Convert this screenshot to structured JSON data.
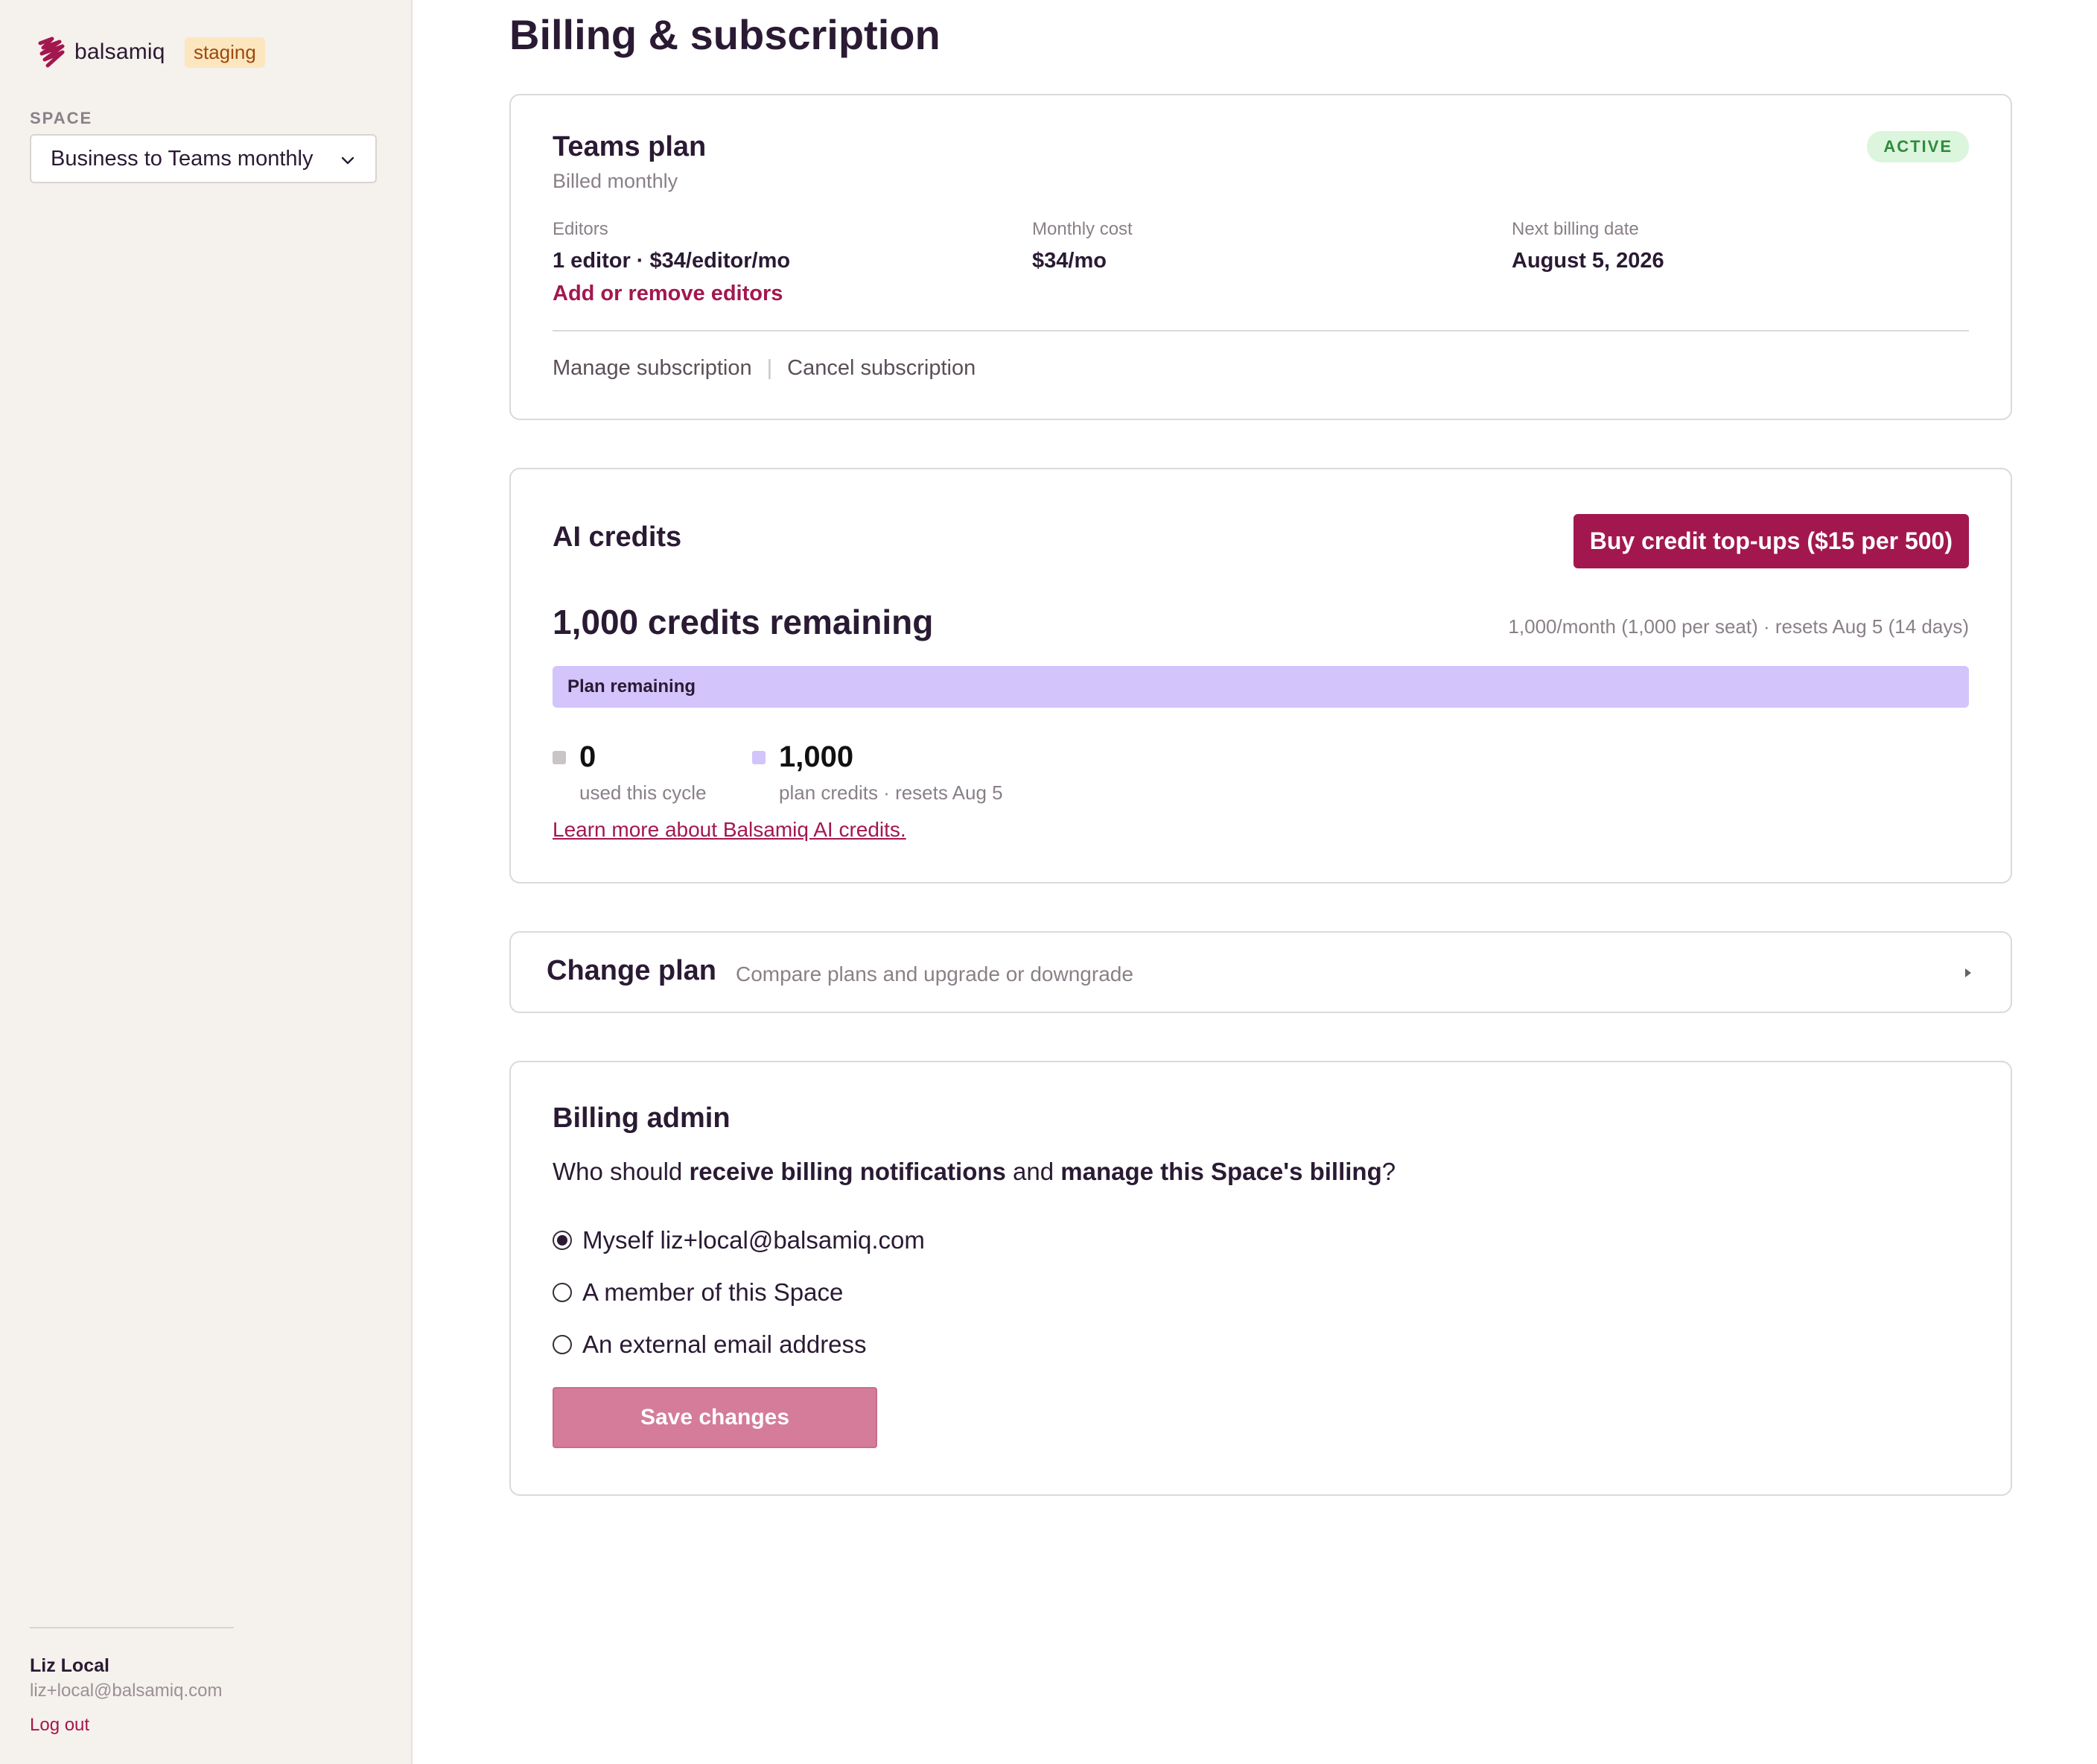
{
  "sidebar": {
    "brand": "balsamiq",
    "env_badge": "staging",
    "space_label": "SPACE",
    "space_value": "Business to Teams monthly",
    "user": {
      "name": "Liz Local",
      "email": "liz+local@balsamiq.com",
      "logout": "Log out"
    }
  },
  "page": {
    "title": "Billing & subscription"
  },
  "plan": {
    "title": "Teams plan",
    "subtitle": "Billed monthly",
    "status": "ACTIVE",
    "editors_label": "Editors",
    "editors_value": "1 editor · $34/editor/mo",
    "cost_label": "Monthly cost",
    "cost_value": "$34/mo",
    "next_label": "Next billing date",
    "next_value": "August 5, 2026",
    "add_editors": "Add or remove editors",
    "manage": "Manage subscription",
    "separator": "|",
    "cancel": "Cancel subscription"
  },
  "credits": {
    "title": "AI credits",
    "buy_button": "Buy credit top-ups ($15 per 500)",
    "remaining": "1,000 credits remaining",
    "cycle_info": "1,000/month (1,000 per seat) · resets Aug 5 (14 days)",
    "bar_label": "Plan remaining",
    "bar_fraction": 1.0,
    "used_value": "0",
    "used_desc": "used this cycle",
    "plan_value": "1,000",
    "plan_desc": "plan credits · resets Aug 5",
    "learn_link": "Learn more about Balsamiq AI credits.",
    "colors": {
      "used": "#c9c4c8",
      "plan": "#d3c4fc"
    }
  },
  "change_plan": {
    "title": "Change plan",
    "description": "Compare plans and upgrade or downgrade"
  },
  "billing_admin": {
    "title": "Billing admin",
    "question_pre": "Who should ",
    "question_b1": "receive billing notifications",
    "question_mid": " and ",
    "question_b2": "manage this Space's billing",
    "question_end": "?",
    "options": [
      {
        "label": "Myself liz+local@balsamiq.com",
        "checked": true
      },
      {
        "label": "A member of this Space",
        "checked": false
      },
      {
        "label": "An external email address",
        "checked": false
      }
    ],
    "save_button": "Save changes"
  },
  "colors": {
    "accent": "#a3174f",
    "save_disabled": "#d47c9a",
    "active_badge_bg": "#dcf5dd",
    "active_badge_text": "#2f8b3c"
  }
}
